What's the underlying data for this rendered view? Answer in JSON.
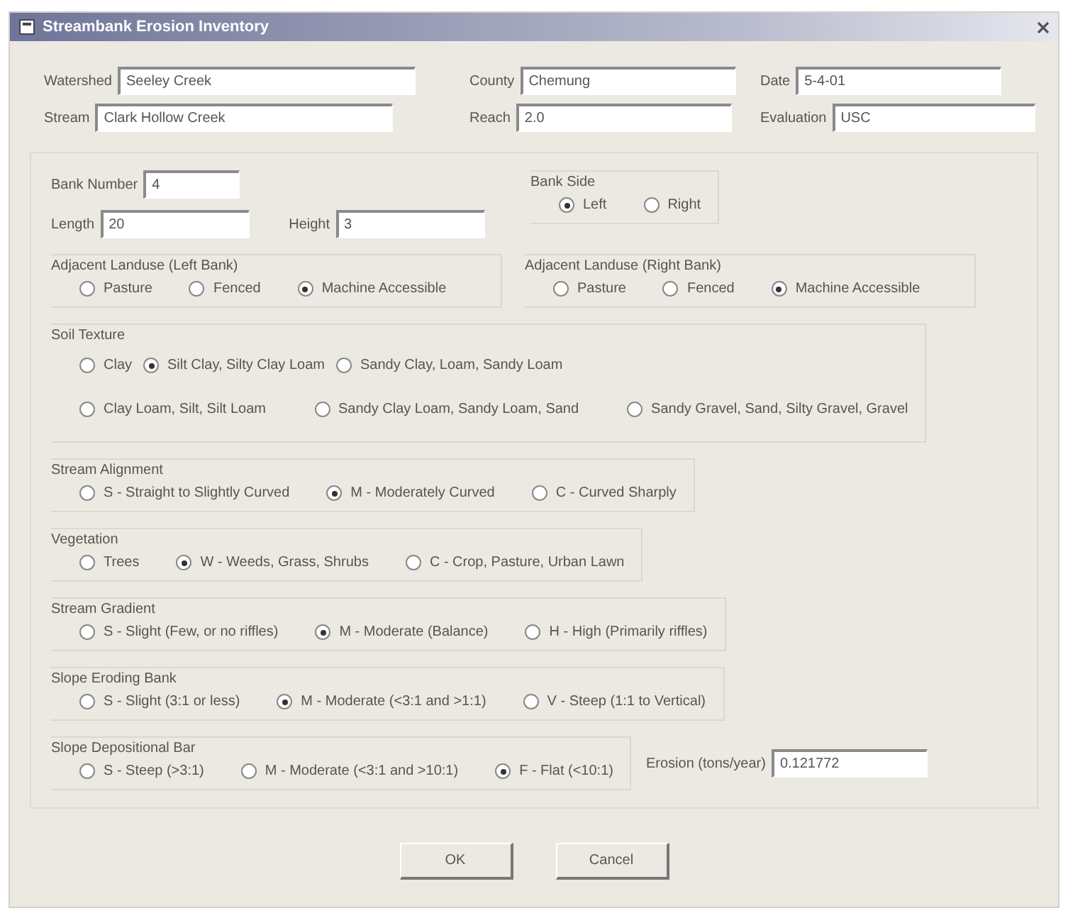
{
  "window": {
    "title": "Streambank Erosion Inventory"
  },
  "header_fields": [
    {
      "label": "Watershed",
      "value": "Seeley Creek"
    },
    {
      "label": "County",
      "value": "Chemung"
    },
    {
      "label": "Date",
      "value": "5-4-01"
    },
    {
      "label": "Stream",
      "value": "Clark Hollow Creek"
    },
    {
      "label": "Reach",
      "value": "2.0"
    },
    {
      "label": "Evaluation",
      "value": "USC"
    }
  ],
  "bank_number": {
    "label": "Bank Number",
    "value": "4"
  },
  "length": {
    "label": "Length",
    "value": "20"
  },
  "height": {
    "label": "Height",
    "value": "3"
  },
  "bank_side": {
    "label": "Bank Side",
    "options": [
      {
        "label": "Left",
        "selected": true
      },
      {
        "label": "Right",
        "selected": false
      }
    ]
  },
  "landuse": [
    {
      "label": "Adjacent Landuse (Left Bank)",
      "options": [
        {
          "label": "Pasture",
          "selected": false
        },
        {
          "label": "Fenced",
          "selected": false
        },
        {
          "label": "Machine Accessible",
          "selected": true
        }
      ]
    },
    {
      "label": "Adjacent Landuse (Right Bank)",
      "options": [
        {
          "label": "Pasture",
          "selected": false
        },
        {
          "label": "Fenced",
          "selected": false
        },
        {
          "label": "Machine Accessible",
          "selected": true
        }
      ]
    }
  ],
  "soil_texture": {
    "label": "Soil Texture",
    "options": [
      {
        "label": "Clay",
        "selected": false
      },
      {
        "label": "Silt Clay, Silty Clay Loam",
        "selected": true
      },
      {
        "label": "Sandy Clay, Loam, Sandy Loam",
        "selected": false
      },
      {
        "label": "Clay Loam, Silt, Silt Loam",
        "selected": false
      },
      {
        "label": "Sandy Clay Loam, Sandy Loam, Sand",
        "selected": false
      },
      {
        "label": "Sandy Gravel, Sand, Silty Gravel, Gravel",
        "selected": false
      }
    ]
  },
  "groups": [
    {
      "label": "Stream Alignment",
      "options": [
        {
          "label": "S - Straight to Slightly Curved",
          "selected": false
        },
        {
          "label": "M - Moderately Curved",
          "selected": true
        },
        {
          "label": "C - Curved Sharply",
          "selected": false
        }
      ]
    },
    {
      "label": "Vegetation",
      "options": [
        {
          "label": "Trees",
          "selected": false
        },
        {
          "label": "W - Weeds, Grass, Shrubs",
          "selected": true
        },
        {
          "label": "C - Crop, Pasture, Urban Lawn",
          "selected": false
        }
      ]
    },
    {
      "label": "Stream Gradient",
      "options": [
        {
          "label": "S - Slight (Few, or no riffles)",
          "selected": false
        },
        {
          "label": "M - Moderate (Balance)",
          "selected": true
        },
        {
          "label": "H - High (Primarily riffles)",
          "selected": false
        }
      ]
    },
    {
      "label": "Slope Eroding Bank",
      "options": [
        {
          "label": "S - Slight (3:1 or less)",
          "selected": false
        },
        {
          "label": "M - Moderate (<3:1 and >1:1)",
          "selected": true
        },
        {
          "label": "V - Steep (1:1 to Vertical)",
          "selected": false
        }
      ]
    },
    {
      "label": "Slope Depositional Bar",
      "options": [
        {
          "label": "S - Steep (>3:1)",
          "selected": false
        },
        {
          "label": "M - Moderate (<3:1 and >10:1)",
          "selected": false
        },
        {
          "label": "F - Flat (<10:1)",
          "selected": true
        }
      ]
    }
  ],
  "erosion": {
    "label": "Erosion (tons/year)",
    "value": "0.121772"
  },
  "buttons": [
    {
      "label": "OK"
    },
    {
      "label": "Cancel"
    }
  ]
}
